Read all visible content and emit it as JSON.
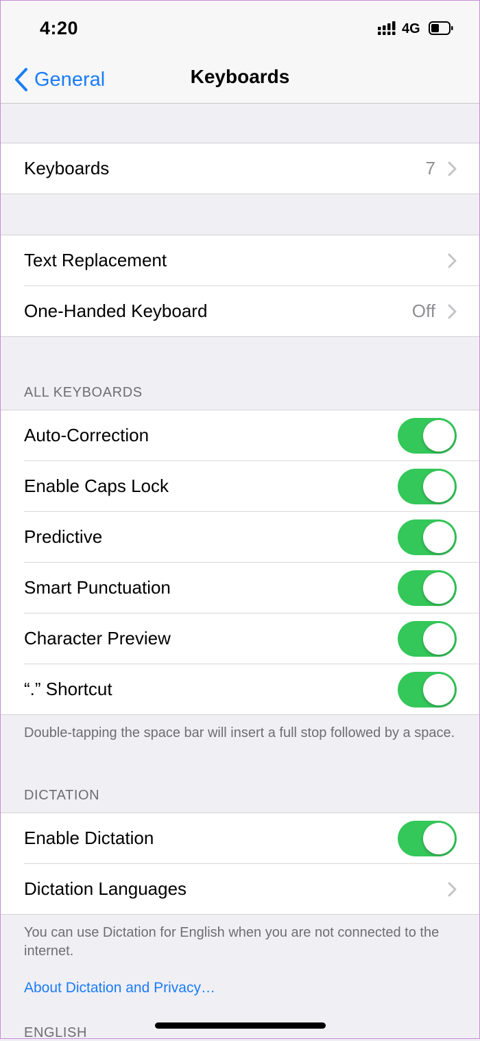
{
  "status": {
    "time": "4:20",
    "network": "4G"
  },
  "nav": {
    "back_label": "General",
    "title": "Keyboards"
  },
  "rows": {
    "keyboards": {
      "label": "Keyboards",
      "value": "7"
    },
    "text_replacement": {
      "label": "Text Replacement"
    },
    "one_handed": {
      "label": "One-Handed Keyboard",
      "value": "Off"
    }
  },
  "all_keyboards": {
    "header": "ALL KEYBOARDS",
    "items": [
      {
        "label": "Auto-Correction",
        "on": true
      },
      {
        "label": "Enable Caps Lock",
        "on": true
      },
      {
        "label": "Predictive",
        "on": true
      },
      {
        "label": "Smart Punctuation",
        "on": true
      },
      {
        "label": "Character Preview",
        "on": true
      },
      {
        "label": "“.” Shortcut",
        "on": true
      }
    ],
    "footer": "Double-tapping the space bar will insert a full stop followed by a space."
  },
  "dictation": {
    "header": "DICTATION",
    "enable": {
      "label": "Enable Dictation",
      "on": true
    },
    "languages": {
      "label": "Dictation Languages"
    },
    "footer": "You can use Dictation for English when you are not connected to the internet.",
    "link": "About Dictation and Privacy…"
  },
  "english": {
    "header": "ENGLISH"
  },
  "colors": {
    "accent": "#1a7cf6",
    "toggle_on": "#34c759",
    "background": "#f0eff4"
  }
}
